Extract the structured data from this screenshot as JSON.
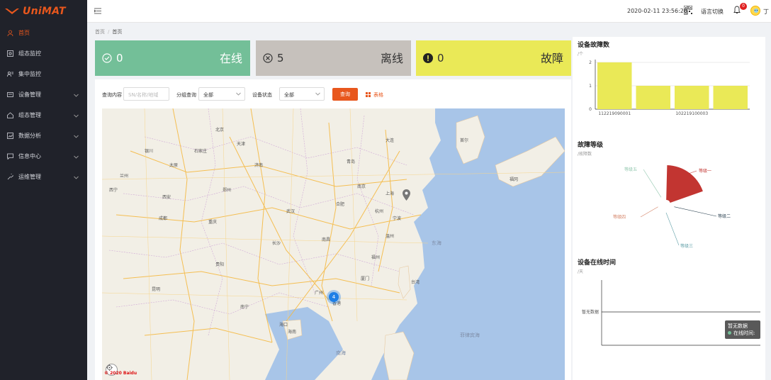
{
  "app": {
    "brand": "UniMAT"
  },
  "sidebar": {
    "items": [
      {
        "label": "首页",
        "icon": "user-icon",
        "active": true,
        "has_submenu": false
      },
      {
        "label": "组态监控",
        "icon": "monitor-icon",
        "active": false,
        "has_submenu": false
      },
      {
        "label": "集中监控",
        "icon": "group-monitor-icon",
        "active": false,
        "has_submenu": false
      },
      {
        "label": "设备管理",
        "icon": "device-icon",
        "active": false,
        "has_submenu": true
      },
      {
        "label": "组态管理",
        "icon": "home-icon",
        "active": false,
        "has_submenu": true
      },
      {
        "label": "数据分析",
        "icon": "analysis-icon",
        "active": false,
        "has_submenu": true
      },
      {
        "label": "信息中心",
        "icon": "message-icon",
        "active": false,
        "has_submenu": true
      },
      {
        "label": "运维管理",
        "icon": "ops-icon",
        "active": false,
        "has_submenu": true
      }
    ]
  },
  "topbar": {
    "datetime": "2020-02-11 23:56:20",
    "language_label": "语言切换",
    "notification_count": "0",
    "user_name": "丁"
  },
  "breadcrumb": {
    "home": "首页",
    "current": "首页"
  },
  "stats": {
    "online": {
      "count": "0",
      "label": "在线",
      "color": "#73bf98"
    },
    "offline": {
      "count": "5",
      "label": "离线",
      "color": "#c6c1bc"
    },
    "fault": {
      "count": "0",
      "label": "故障",
      "color": "#eae957"
    }
  },
  "filter": {
    "query_label": "查询内容",
    "query_placeholder": "SN/名称/地域",
    "group_label": "分组查询",
    "group_value": "全部",
    "status_label": "设备状态",
    "status_value": "全部",
    "query_button": "查询",
    "table_button": "表格"
  },
  "map": {
    "cluster_count": "4",
    "sea_labels": [
      "东海",
      "南海",
      "菲律宾海"
    ],
    "city_labels": [
      "北京",
      "天津",
      "石家庄",
      "太原",
      "济南",
      "郑州",
      "西安",
      "南京",
      "上海",
      "杭州",
      "合肥",
      "武汉",
      "长沙",
      "南昌",
      "福州",
      "广州",
      "南宁",
      "重庆",
      "成都",
      "贵阳",
      "昆明",
      "兰州",
      "银川",
      "西宁",
      "台湾",
      "海南",
      "青岛",
      "大连",
      "首尔",
      "福冈",
      "宁波",
      "温州",
      "香港",
      "厦门",
      "海口"
    ],
    "copyright": "© 2020 Baidu"
  },
  "right": {
    "fault_chart": {
      "title": "设备故障数",
      "unit": "/个",
      "type": "bar",
      "categories": [
        "112219090001",
        "",
        "102219100003",
        ""
      ],
      "values": [
        2,
        1,
        1,
        1
      ],
      "ylim": [
        0,
        2
      ],
      "yticks": [
        "0",
        "1",
        "2"
      ],
      "color": "#eae957"
    },
    "fault_level_chart": {
      "title": "故障等级",
      "unit": "/故障数",
      "type": "pie",
      "labels": [
        "等级一",
        "等级二",
        "等级三",
        "等级四",
        "等级五"
      ],
      "values": [
        1,
        0,
        0,
        0,
        0
      ],
      "colors": [
        "#c23531",
        "#2f4554",
        "#61a0a8",
        "#d48265",
        "#91c7ae"
      ]
    },
    "online_time_chart": {
      "title": "设备在线时间",
      "unit": "/天",
      "no_data": "暂无数据",
      "tooltip_title": "暂无数据",
      "tooltip_item": "在线时间: -"
    }
  }
}
